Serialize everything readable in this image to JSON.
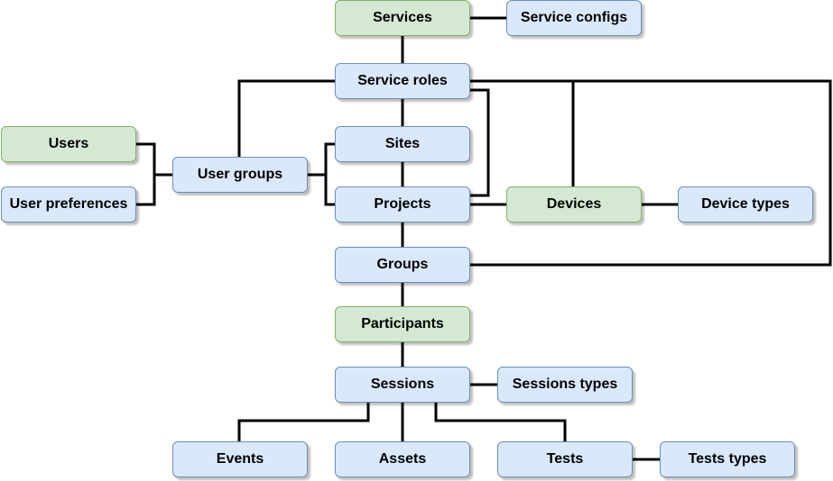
{
  "colors": {
    "entity_fill": "#dae8fc",
    "entity_stroke": "#6c8ebf",
    "root_fill": "#d5e8d4",
    "root_stroke": "#82b366",
    "edge": "#000000"
  },
  "nodes": {
    "services": {
      "label": "Services",
      "kind": "green"
    },
    "service_configs": {
      "label": "Service configs",
      "kind": "blue"
    },
    "service_roles": {
      "label": "Service roles",
      "kind": "blue"
    },
    "sites": {
      "label": "Sites",
      "kind": "blue"
    },
    "projects": {
      "label": "Projects",
      "kind": "blue"
    },
    "groups": {
      "label": "Groups",
      "kind": "blue"
    },
    "participants": {
      "label": "Participants",
      "kind": "green"
    },
    "sessions": {
      "label": "Sessions",
      "kind": "blue"
    },
    "sessions_types": {
      "label": "Sessions types",
      "kind": "blue"
    },
    "events": {
      "label": "Events",
      "kind": "blue"
    },
    "assets": {
      "label": "Assets",
      "kind": "blue"
    },
    "tests": {
      "label": "Tests",
      "kind": "blue"
    },
    "tests_types": {
      "label": "Tests types",
      "kind": "blue"
    },
    "users": {
      "label": "Users",
      "kind": "green"
    },
    "user_preferences": {
      "label": "User preferences",
      "kind": "blue"
    },
    "user_groups": {
      "label": "User groups",
      "kind": "blue"
    },
    "devices": {
      "label": "Devices",
      "kind": "green"
    },
    "device_types": {
      "label": "Device types",
      "kind": "blue"
    }
  }
}
